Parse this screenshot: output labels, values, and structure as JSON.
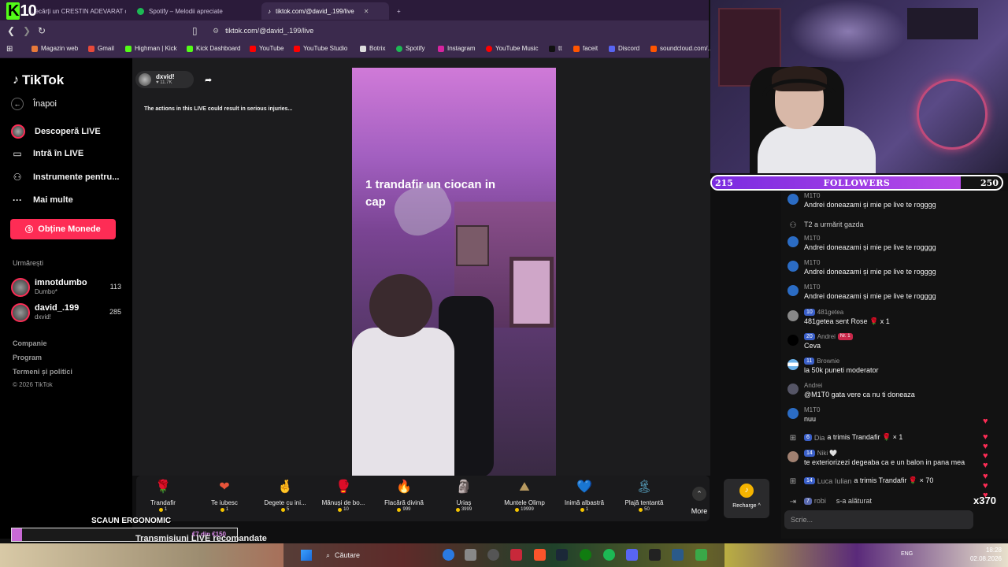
{
  "browser": {
    "logo_k": "K",
    "logo_num": "10",
    "tabs": [
      {
        "label": "...ecărți un CRESTIN ADEVARAT c...",
        "active": false
      },
      {
        "label": "Spotify – Melodii apreciate",
        "active": false
      },
      {
        "label": "tiktok.com/@david_.199/live",
        "active": true
      }
    ],
    "url": "tiktok.com/@david_.199/live",
    "bookmarks": [
      "Magazin web",
      "Gmail",
      "Highman | Kick",
      "Kick Dashboard",
      "YouTube",
      "YouTube Studio",
      "Botrix",
      "Spotify",
      "Instagram",
      "YouTube Music",
      "tt",
      "faceit",
      "Discord",
      "soundcloud.com/..."
    ]
  },
  "sidebar": {
    "logo": "TikTok",
    "back": "Înapoi",
    "items": [
      {
        "label": "Descoperă LIVE",
        "icon": "live-avatar-icon"
      },
      {
        "label": "Intră în LIVE",
        "icon": "camera-icon"
      },
      {
        "label": "Instrumente pentru...",
        "icon": "tools-icon"
      },
      {
        "label": "Mai multe",
        "icon": "more-icon"
      }
    ],
    "coins_button": "Obține Monede",
    "following_title": "Urmărești",
    "following": [
      {
        "name": "imnotdumbo",
        "sub": "Dumbo*",
        "count": "113"
      },
      {
        "name": "david_.199",
        "sub": "dxvid!",
        "count": "285"
      }
    ],
    "footer": [
      "Companie",
      "Program",
      "Termeni și politici",
      "© 2026 TikTok"
    ]
  },
  "live": {
    "host_name": "dxvid!",
    "host_likes": "♥ 11.7K",
    "warning": "The actions in this LIVE could result in serious injuries...",
    "caption_line1": "1 trandafir un ciocan in",
    "caption_line2": "cap"
  },
  "gifts": [
    {
      "name": "Trandafir",
      "price": "1",
      "icon": "🌹",
      "color": "#c8284a"
    },
    {
      "name": "Te iubesc",
      "price": "1",
      "icon": "❤",
      "color": "#e8543a"
    },
    {
      "name": "Degete cu ini...",
      "price": "5",
      "icon": "🤞",
      "color": "#e87a7a"
    },
    {
      "name": "Mănuși de bo...",
      "price": "10",
      "icon": "🥊",
      "color": "#f2d35a"
    },
    {
      "name": "Flacără divină",
      "price": "999",
      "icon": "🔥",
      "color": "#c8a040"
    },
    {
      "name": "Uriaș",
      "price": "3999",
      "icon": "🗿",
      "color": "#8aa060"
    },
    {
      "name": "Muntele Olimp",
      "price": "19999",
      "icon": "⛰",
      "color": "#b89a60"
    },
    {
      "name": "Inimă albastră",
      "price": "1",
      "icon": "💙",
      "color": "#5ac8e8"
    },
    {
      "name": "Plajă tentantă",
      "price": "50",
      "icon": "🏝",
      "color": "#5aa8c8"
    }
  ],
  "gift_more": "More",
  "recharge": "Recharge ^",
  "goal": {
    "start": "215",
    "label": "FOLLOWERS",
    "end": "250",
    "progress": 0.86
  },
  "chat": [
    {
      "type": "msg",
      "user": "M1T0",
      "text": "Andrei doneazami și mie pe live te rogggg"
    },
    {
      "type": "sys",
      "text": "T2  a urmărit gazda"
    },
    {
      "type": "msg",
      "user": "M1T0",
      "text": "Andrei doneazami și mie pe live te rogggg"
    },
    {
      "type": "msg",
      "user": "M1T0",
      "text": "Andrei doneazami și mie pe live te rogggg"
    },
    {
      "type": "msg",
      "user": "M1T0",
      "text": "Andrei doneazami și mie pe live te rogggg"
    },
    {
      "type": "msg",
      "user": "481getea",
      "level": "10",
      "text": "481getea sent Rose 🌹 x 1"
    },
    {
      "type": "msg",
      "user": "Andrei",
      "level": "20",
      "badge": "Nr. 1",
      "text": "Ceva"
    },
    {
      "type": "msg",
      "user": "Brownie",
      "level": "11",
      "text": "la 50k puneti moderator"
    },
    {
      "type": "msg",
      "user": "Andrei",
      "text": "@M1T0 gata vere ca nu ti doneaza"
    },
    {
      "type": "msg",
      "user": "M1T0",
      "text": "nuu"
    },
    {
      "type": "gift",
      "user": "Dia",
      "level": "6",
      "text": "a trimis Trandafir 🌹 × 1"
    },
    {
      "type": "msg",
      "user": "Niki 🤍",
      "level": "14",
      "text": "te exteriorizezi degeaba ca e un balon in pana mea"
    },
    {
      "type": "gift",
      "user": "Luca Iulian",
      "level": "14",
      "text": "a trimis Trandafir 🌹 × 70"
    },
    {
      "type": "join",
      "user": "robi",
      "level": "7",
      "text": "s-a alăturat"
    }
  ],
  "combo": "x370",
  "chat_placeholder": "Scrie...",
  "overlay": {
    "scaun": "SCAUN ERGONOMIC",
    "donation_text": "€7 din €150",
    "donation_progress": 0.047,
    "recommended": "Transmisiuni LIVE recomandate"
  },
  "taskbar": {
    "search": "Căutare",
    "lang": "ENG",
    "time": "18:28",
    "date": "02.08.2026"
  }
}
